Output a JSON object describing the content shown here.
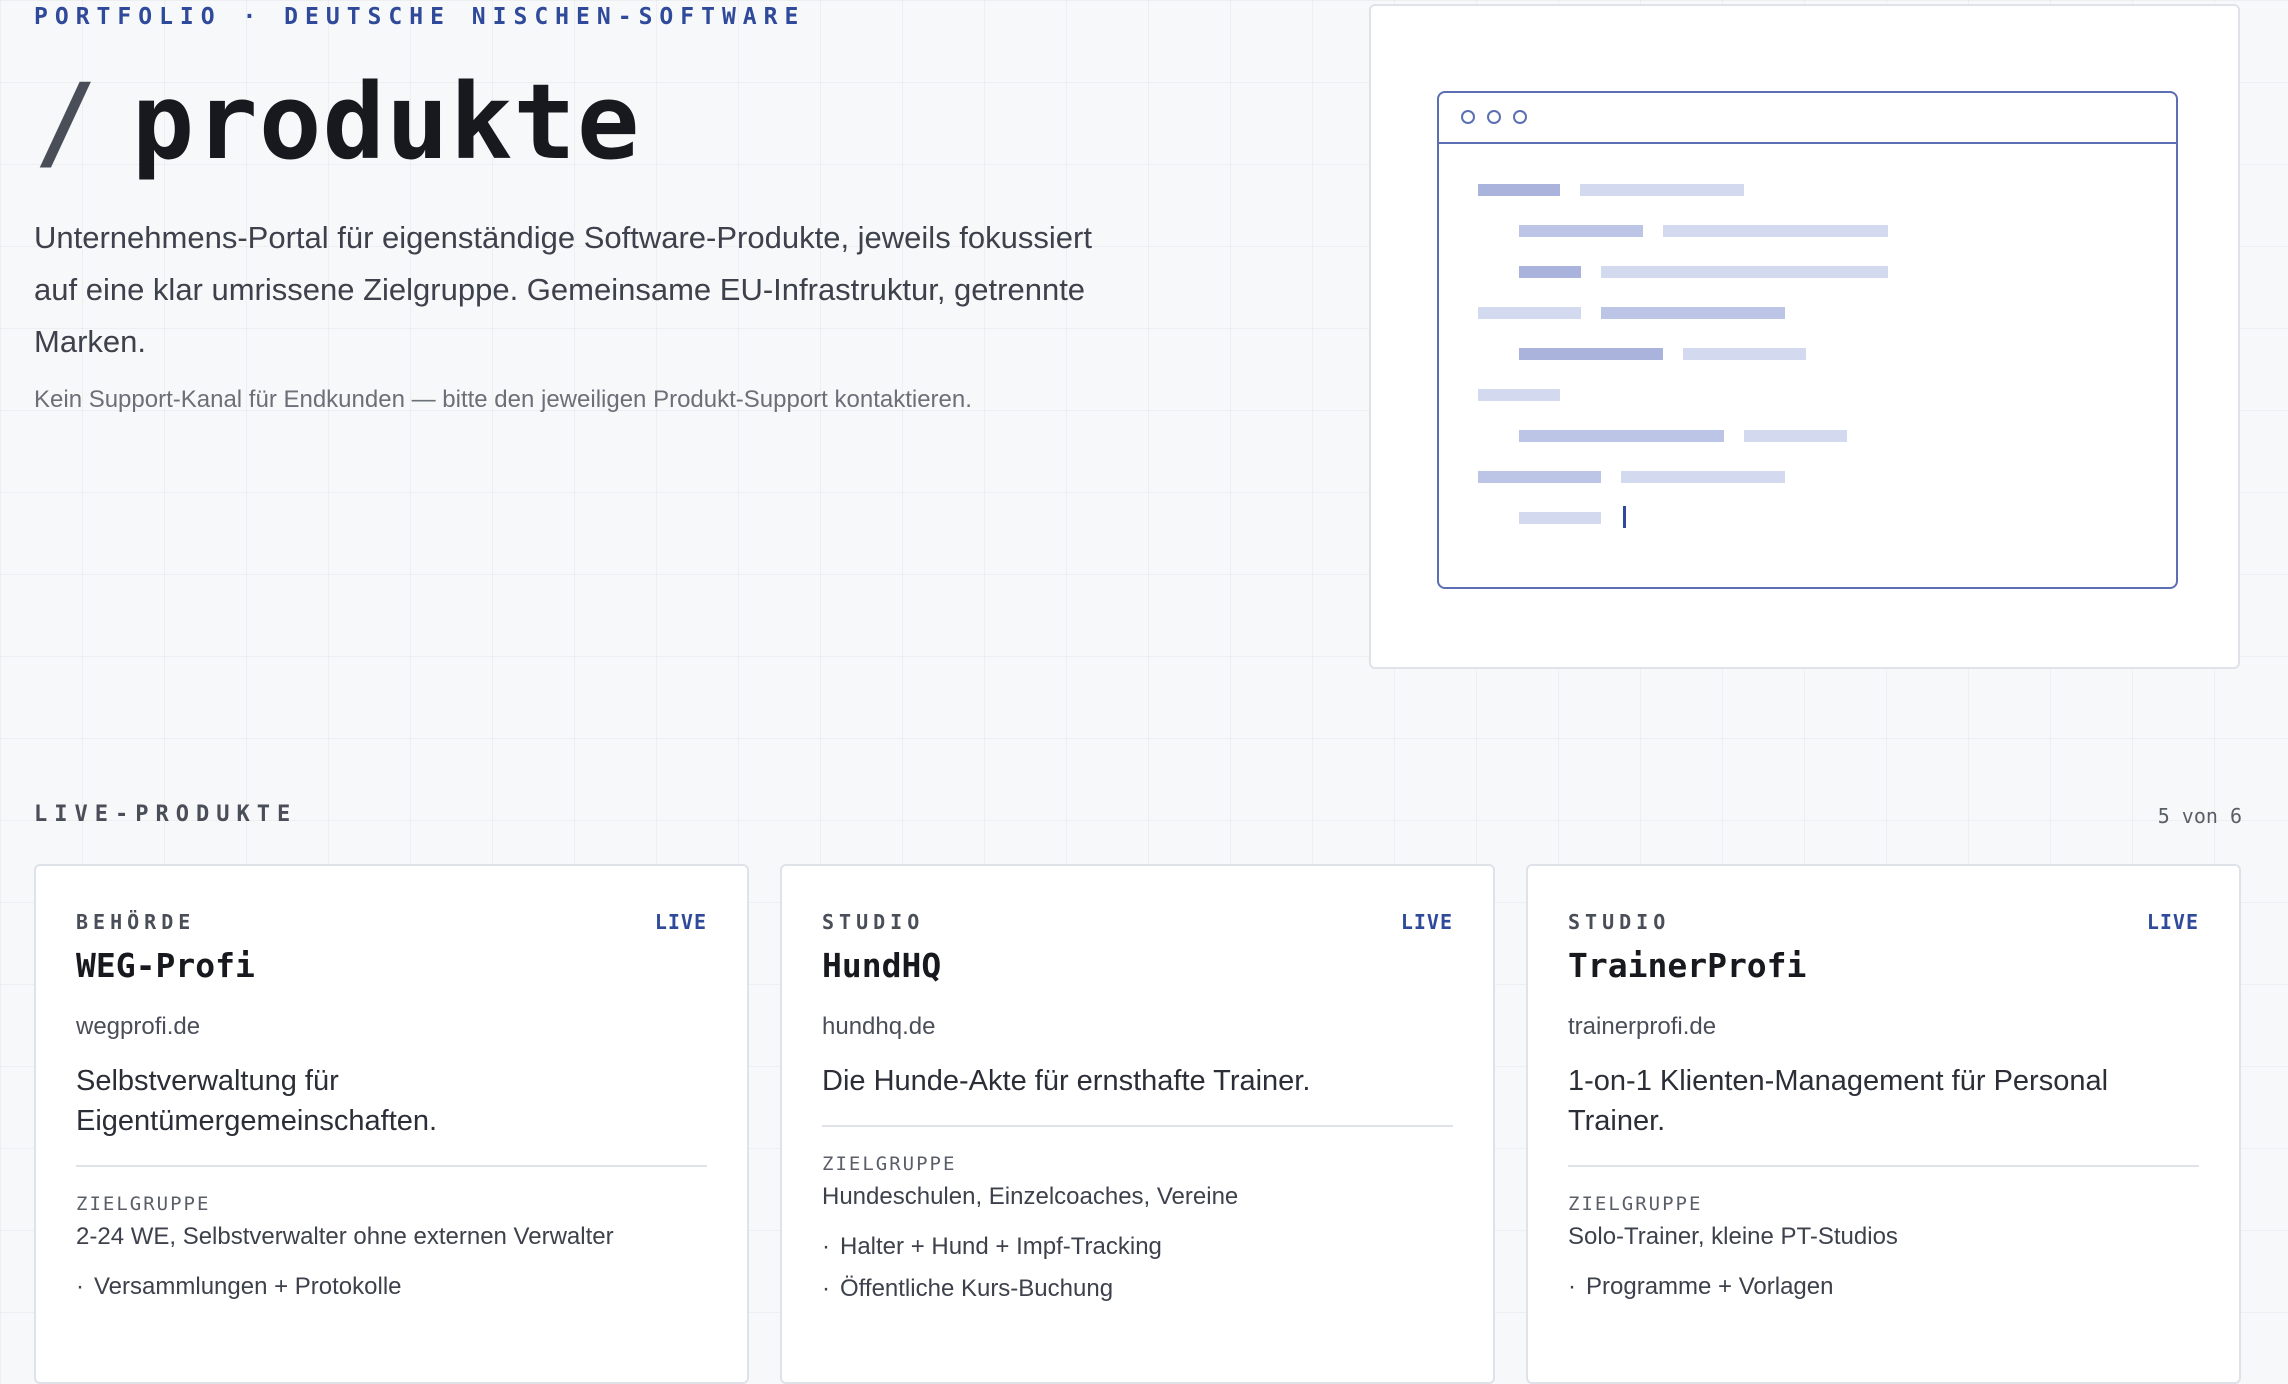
{
  "hero": {
    "eyebrow": "PORTFOLIO · DEUTSCHE NISCHEN-SOFTWARE",
    "title_slash": "/",
    "title": "produkte",
    "lead": "Unternehmens-Portal für eigenständige Software-Produkte, jeweils fokussiert auf eine klar umrissene Zielgruppe. Gemeinsame EU-Infrastruktur, getrennte Marken.",
    "note": "Kein Support-Kanal für Endkunden — bitte den jeweiligen Produkt-Support kontaktieren."
  },
  "colors": {
    "accent": "#2f4a9a",
    "illustration_stroke": "#5b6fb2",
    "bar_dark": "#a9b3dc",
    "bar_light": "#d3d9ef"
  },
  "section": {
    "label": "LIVE-PRODUKTE",
    "count": "5 von 6"
  },
  "products": [
    {
      "category": "BEHÖRDE",
      "status": "LIVE",
      "name": "WEG-Profi",
      "domain": "wegprofi.de",
      "tagline": "Selbstverwaltung für Eigentümergemeinschaften.",
      "target_label": "ZIELGRUPPE",
      "target": "2-24 WE, Selbstverwalter ohne externen Verwalter",
      "features": [
        "Versammlungen + Protokolle"
      ]
    },
    {
      "category": "STUDIO",
      "status": "LIVE",
      "name": "HundHQ",
      "domain": "hundhq.de",
      "tagline": "Die Hunde-Akte für ernsthafte Trainer.",
      "target_label": "ZIELGRUPPE",
      "target": "Hundeschulen, Einzelcoaches, Vereine",
      "features": [
        "Halter + Hund + Impf-Tracking",
        "Öffentliche Kurs-Buchung"
      ]
    },
    {
      "category": "STUDIO",
      "status": "LIVE",
      "name": "TrainerProfi",
      "domain": "trainerprofi.de",
      "tagline": "1-on-1 Klienten-Management für Personal Trainer.",
      "target_label": "ZIELGRUPPE",
      "target": "Solo-Trainer, kleine PT-Studios",
      "features": [
        "Programme + Vorlagen"
      ]
    }
  ]
}
